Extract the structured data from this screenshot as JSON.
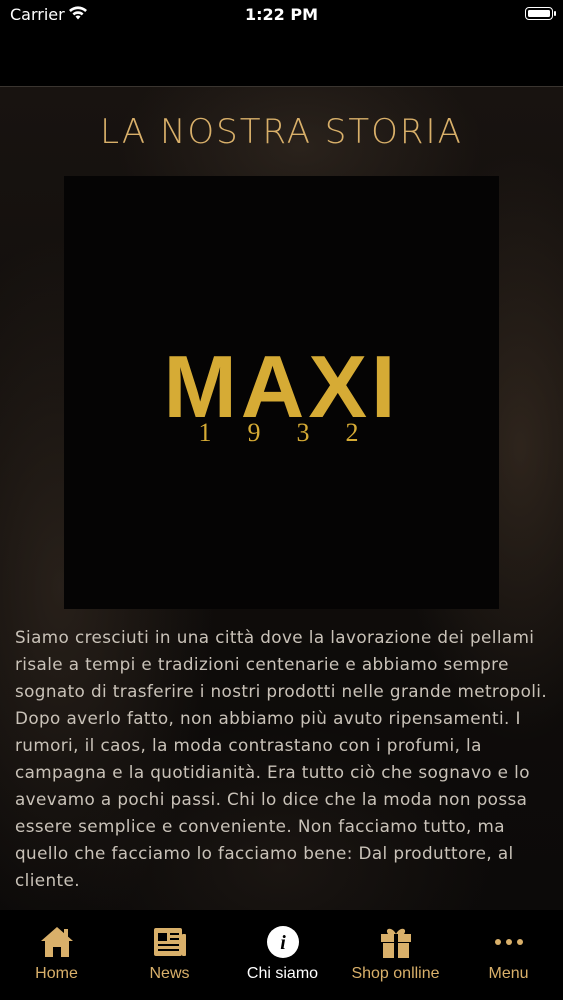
{
  "status_bar": {
    "carrier": "Carrier",
    "time": "1:22 PM"
  },
  "page": {
    "title": "LA NOSTRA STORIA"
  },
  "logo": {
    "word": "MAXI",
    "year": "1932"
  },
  "story": {
    "text": "Siamo cresciuti in una città dove la lavorazione dei pellami risale a tempi e tradizioni centenarie e abbiamo sempre sognato di trasferire i nostri prodotti nelle grande metropoli. Dopo averlo fatto, non abbiamo più avuto ripensamenti. I rumori, il caos, la moda contrastano con i profumi, la campagna e la quotidianità. Era tutto ciò che sognavo e lo avevamo a pochi passi. Chi lo dice che la moda non possa essere semplice e conveniente. Non facciamo tutto, ma quello che facciamo lo facciamo bene: Dal produttore, al cliente."
  },
  "tabs": [
    {
      "label": "Home",
      "icon": "home-icon",
      "active": false
    },
    {
      "label": "News",
      "icon": "newspaper-icon",
      "active": false
    },
    {
      "label": "Chi siamo",
      "icon": "info-icon",
      "active": true
    },
    {
      "label": "Shop onlline",
      "icon": "gift-icon",
      "active": false
    },
    {
      "label": "Menu",
      "icon": "more-icon",
      "active": false
    }
  ],
  "colors": {
    "accent": "#d9b06a",
    "logo_gold": "#d6ab35",
    "text": "#c9c2b8",
    "background": "#0b0908"
  }
}
